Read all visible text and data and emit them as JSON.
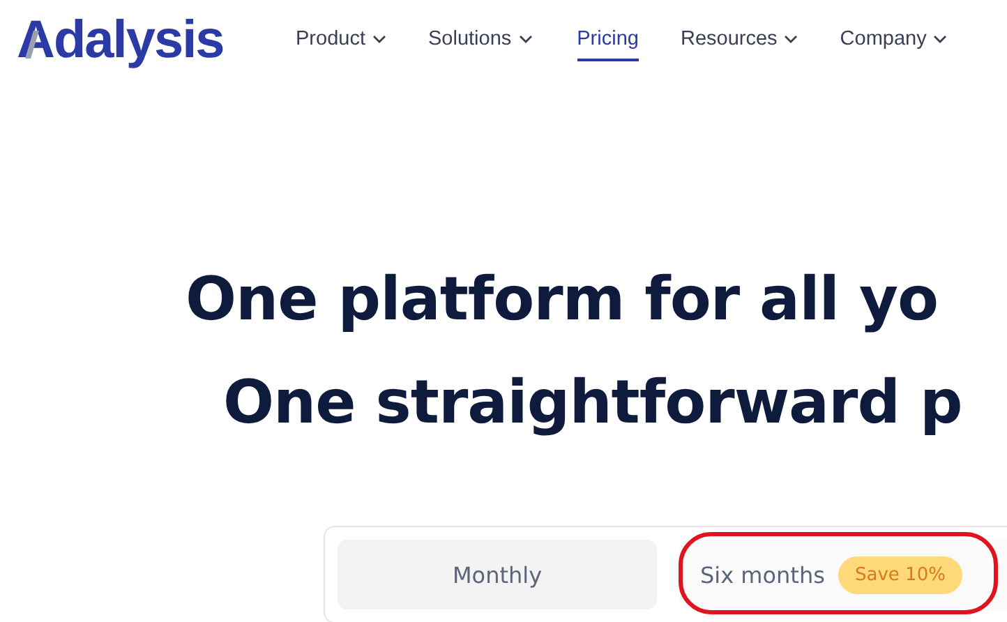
{
  "logo": {
    "text": "Adalysis"
  },
  "nav": [
    {
      "label": "Product",
      "dropdown": true,
      "selected": false
    },
    {
      "label": "Solutions",
      "dropdown": true,
      "selected": false
    },
    {
      "label": "Pricing",
      "dropdown": false,
      "selected": true
    },
    {
      "label": "Resources",
      "dropdown": true,
      "selected": false
    },
    {
      "label": "Company",
      "dropdown": true,
      "selected": false
    }
  ],
  "headline": [
    "One platform for all yo",
    "One straightforward p"
  ],
  "billing_toggle": [
    {
      "label": "Monthly",
      "selected": true
    },
    {
      "label": "Six months",
      "selected": false,
      "badge": "Save 10%"
    }
  ],
  "annotation": {
    "kind": "ellipse"
  }
}
